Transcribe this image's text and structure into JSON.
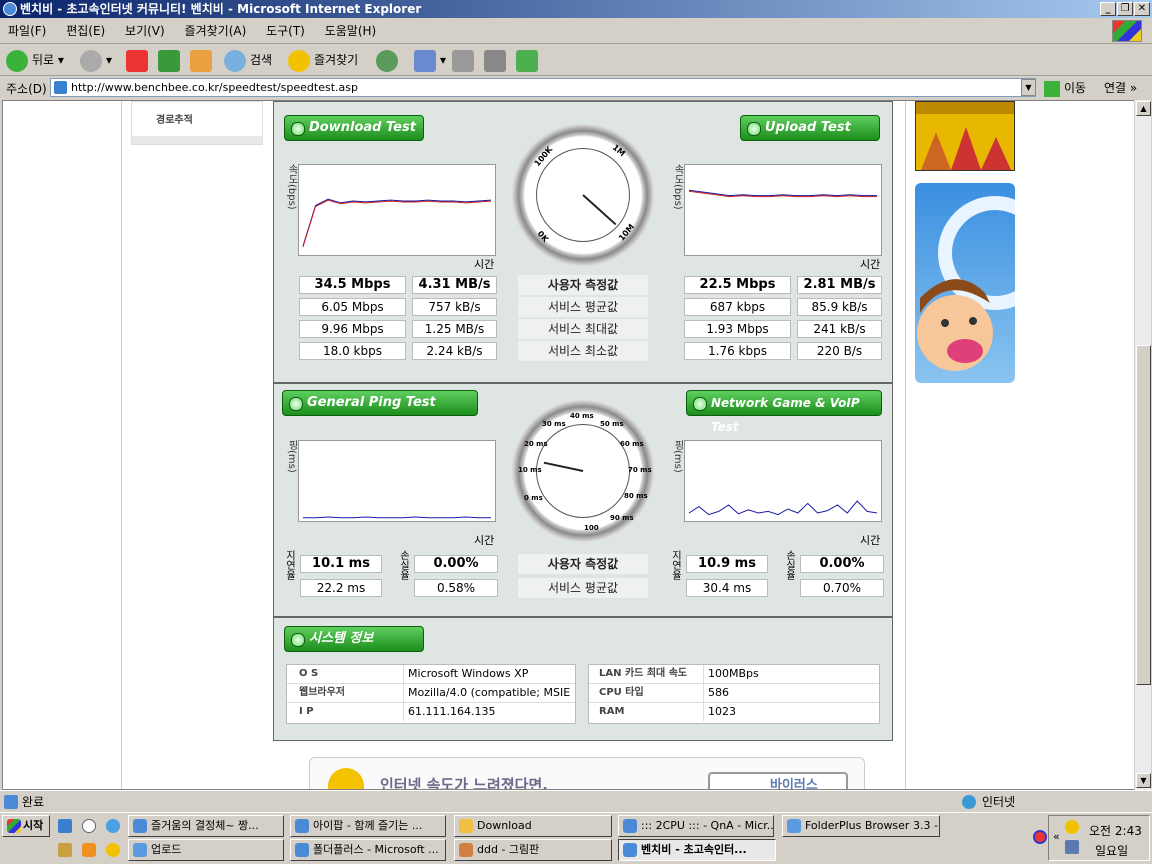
{
  "window": {
    "title": "벤치비 - 초고속인터넷 커뮤니티! 벤치비 - Microsoft Internet Explorer"
  },
  "menu": [
    "파일(F)",
    "편집(E)",
    "보기(V)",
    "즐겨찾기(A)",
    "도구(T)",
    "도움말(H)"
  ],
  "toolbar": {
    "back": "뒤로",
    "search": "검색",
    "favorites": "즐겨찾기"
  },
  "address": {
    "label": "주소(D)",
    "url": "http://www.benchbee.co.kr/speedtest/speedtest.asp",
    "go": "이동",
    "links": "연결"
  },
  "sidebar": {
    "menu_item": "경로추적"
  },
  "speed": {
    "download_title": "Download Test",
    "upload_title": "Upload Test",
    "y_label": "속도(bps)",
    "x_label": "시간",
    "gauge_labels": [
      "100K",
      "1M",
      "10M",
      "0K"
    ],
    "rows": [
      {
        "label": "사용자 측정값",
        "dl_bps": "34.5 Mbps",
        "dl_bytes": "4.31 MB/s",
        "ul_bps": "22.5 Mbps",
        "ul_bytes": "2.81 MB/s"
      },
      {
        "label": "서비스 평균값",
        "dl_bps": "6.05 Mbps",
        "dl_bytes": "757 kB/s",
        "ul_bps": "687 kbps",
        "ul_bytes": "85.9 kB/s"
      },
      {
        "label": "서비스 최대값",
        "dl_bps": "9.96 Mbps",
        "dl_bytes": "1.25 MB/s",
        "ul_bps": "1.93 Mbps",
        "ul_bytes": "241 kB/s"
      },
      {
        "label": "서비스 최소값",
        "dl_bps": "18.0 kbps",
        "dl_bytes": "2.24 kB/s",
        "ul_bps": "1.76 kbps",
        "ul_bytes": "220 B/s"
      }
    ]
  },
  "ping": {
    "general_title": "General Ping Test",
    "game_title": "Network Game & VoIP Test",
    "y_label": "핑(ms)",
    "x_label": "시간",
    "latency_label": "지연율",
    "loss_label": "손실율",
    "gauge_labels": [
      "40 ms",
      "50 ms",
      "60 ms",
      "30 ms",
      "70 ms",
      "20 ms",
      "80 ms",
      "10 ms",
      "90 ms",
      "0 ms",
      "100"
    ],
    "rows": [
      {
        "label": "사용자 측정값",
        "gen_latency": "10.1 ms",
        "gen_loss": "0.00%",
        "game_latency": "10.9 ms",
        "game_loss": "0.00%"
      },
      {
        "label": "서비스 평균값",
        "gen_latency": "22.2 ms",
        "gen_loss": "0.58%",
        "game_latency": "30.4 ms",
        "game_loss": "0.70%"
      }
    ]
  },
  "sysinfo": {
    "title": "시스템 정보",
    "left": [
      {
        "k": "O S",
        "v": "Microsoft Windows XP"
      },
      {
        "k": "웹브라우저",
        "v": "Mozilla/4.0 (compatible; MSIE"
      },
      {
        "k": "I P",
        "v": "61.111.164.135"
      }
    ],
    "right": [
      {
        "k": "LAN 카드 최대 속도",
        "v": "100MBps"
      },
      {
        "k": "CPU 타입",
        "v": "586"
      },
      {
        "k": "RAM",
        "v": "1023"
      }
    ]
  },
  "banner": {
    "text": "인터넷 속도가 느려졌다면,",
    "button": "바이러스"
  },
  "status": {
    "text": "완료",
    "zone": "인터넷"
  },
  "taskbar": {
    "start": "시작",
    "row1": [
      "즐거움의 결정체~ 짱...",
      "아이팝 - 함께 즐기는 ...",
      "Download",
      "::: 2CPU ::: - QnA - Micr...",
      "FolderPlus Browser 3.3 - ..."
    ],
    "row2": [
      "업로드",
      "폴더플러스 - Microsoft ...",
      "ddd - 그림판",
      "벤치비 - 초고속인터..."
    ],
    "clock": "오전 2:43",
    "day": "일요일"
  },
  "chart_data": [
    {
      "type": "line",
      "title": "Download Test",
      "ylabel": "속도(bps)",
      "xlabel": "시간",
      "series": [
        {
          "values": [
            0.1,
            0.55,
            0.62,
            0.58,
            0.6,
            0.59,
            0.6,
            0.61,
            0.6,
            0.6,
            0.61,
            0.6,
            0.6,
            0.59,
            0.6,
            0.61
          ]
        }
      ]
    },
    {
      "type": "line",
      "title": "Upload Test",
      "ylabel": "속도(bps)",
      "xlabel": "시간",
      "series": [
        {
          "values": [
            0.72,
            0.7,
            0.68,
            0.66,
            0.67,
            0.66,
            0.66,
            0.67,
            0.66,
            0.66,
            0.67,
            0.66,
            0.67,
            0.66,
            0.66
          ]
        }
      ]
    },
    {
      "type": "line",
      "title": "General Ping Test",
      "ylabel": "핑(ms)",
      "xlabel": "시간",
      "series": [
        {
          "values": [
            0.04,
            0.04,
            0.05,
            0.04,
            0.04,
            0.05,
            0.04,
            0.04,
            0.04,
            0.05,
            0.04,
            0.04,
            0.04,
            0.05,
            0.04,
            0.04
          ]
        }
      ]
    },
    {
      "type": "line",
      "title": "Network Game & VoIP Test",
      "ylabel": "핑(ms)",
      "xlabel": "시간",
      "series": [
        {
          "values": [
            0.1,
            0.18,
            0.08,
            0.12,
            0.2,
            0.09,
            0.14,
            0.1,
            0.12,
            0.08,
            0.15,
            0.1,
            0.22,
            0.1,
            0.13,
            0.2,
            0.1,
            0.25,
            0.12,
            0.1
          ]
        }
      ]
    }
  ]
}
